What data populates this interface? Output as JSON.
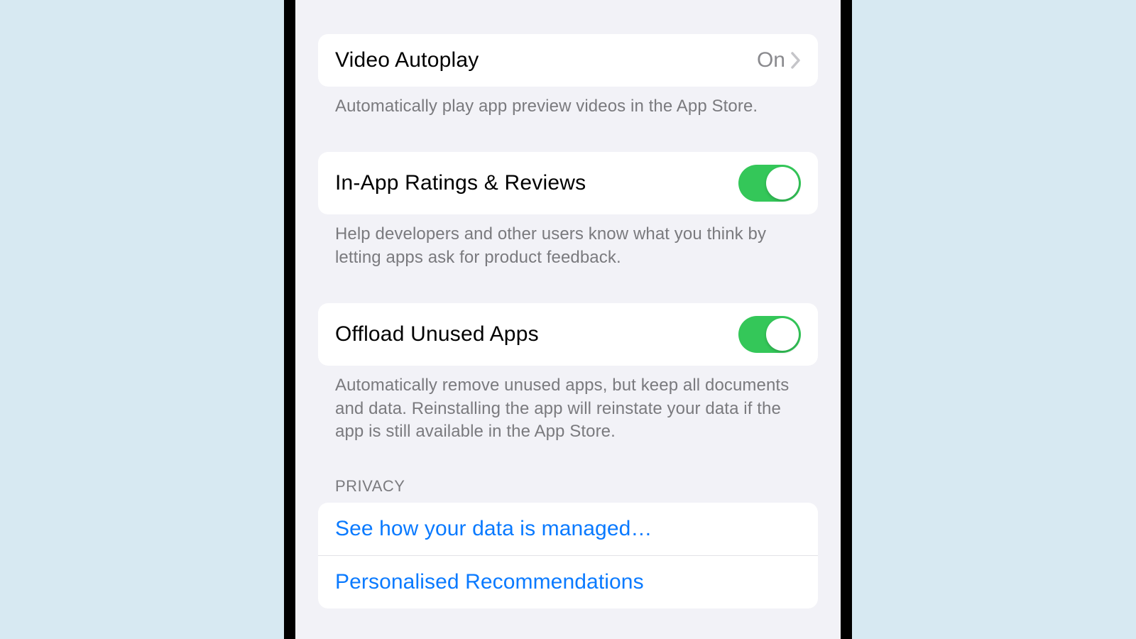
{
  "settings": {
    "video_autoplay": {
      "label": "Video Autoplay",
      "value": "On",
      "caption": "Automatically play app preview videos in the App Store."
    },
    "in_app_ratings": {
      "label": "In-App Ratings & Reviews",
      "enabled": true,
      "caption": "Help developers and other users know what you think by letting apps ask for product feedback."
    },
    "offload_unused": {
      "label": "Offload Unused Apps",
      "enabled": true,
      "caption": "Automatically remove unused apps, but keep all documents and data. Reinstalling the app will reinstate your data if the app is still available in the App Store."
    }
  },
  "privacy": {
    "header": "PRIVACY",
    "links": {
      "data_managed": "See how your data is managed…",
      "personalised": "Personalised Recommendations"
    }
  }
}
